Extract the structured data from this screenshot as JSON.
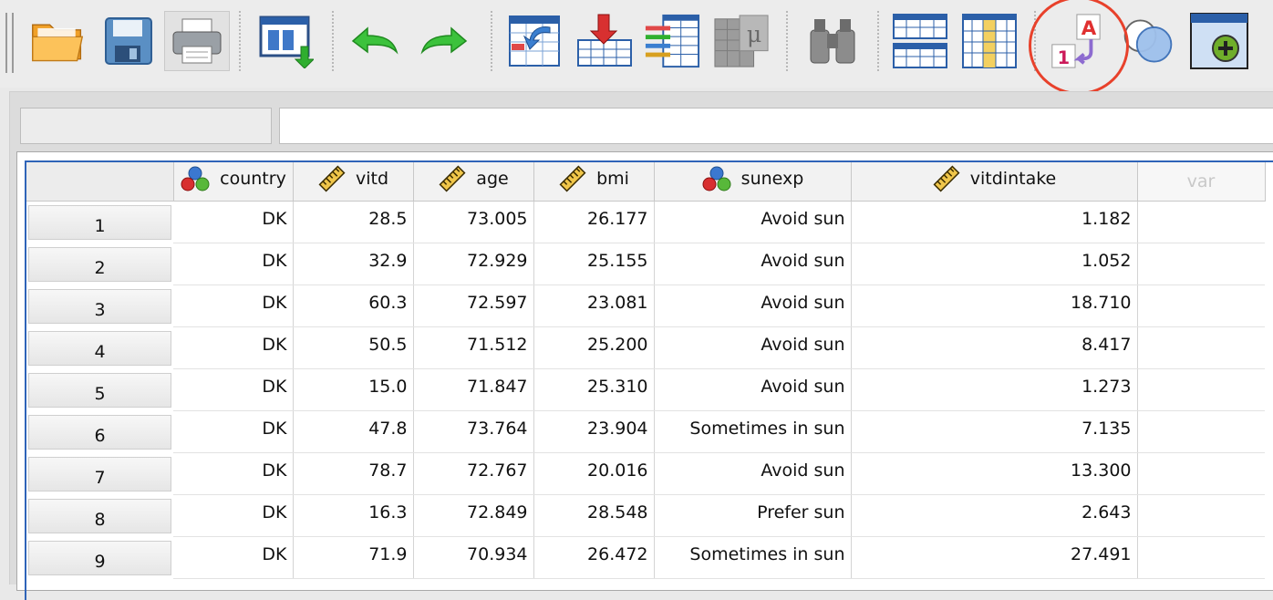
{
  "toolbar": {
    "buttons": [
      {
        "name": "open-data-button",
        "icon": "folder-open-icon"
      },
      {
        "name": "save-button",
        "icon": "floppy-disk-icon"
      },
      {
        "name": "print-button",
        "icon": "printer-icon"
      },
      {
        "name": "recall-dialog-button",
        "icon": "recall-dialog-icon"
      },
      {
        "name": "undo-button",
        "icon": "undo-arrow-icon"
      },
      {
        "name": "redo-button",
        "icon": "redo-arrow-icon"
      },
      {
        "name": "go-to-case-button",
        "icon": "go-to-case-icon"
      },
      {
        "name": "go-to-variable-button",
        "icon": "go-to-variable-icon"
      },
      {
        "name": "variables-button",
        "icon": "variables-list-icon"
      },
      {
        "name": "run-descriptives-button",
        "icon": "mu-statistics-icon"
      },
      {
        "name": "find-button",
        "icon": "binoculars-icon"
      },
      {
        "name": "insert-cases-button",
        "icon": "insert-cases-icon"
      },
      {
        "name": "insert-variable-button",
        "icon": "insert-variable-icon"
      },
      {
        "name": "value-labels-button",
        "icon": "value-labels-icon"
      },
      {
        "name": "use-variable-sets-button",
        "icon": "variable-sets-circles-icon"
      },
      {
        "name": "add-extension-button",
        "icon": "add-plus-icon"
      }
    ]
  },
  "colors": {
    "annotation": "#e8412b",
    "grid_frame": "#2f64b8",
    "header_bg": "#f2f2f2"
  },
  "grid": {
    "columns": [
      {
        "label": "country",
        "icon": "nominal-measure-icon",
        "align": "right"
      },
      {
        "label": "vitd",
        "icon": "scale-ruler-icon",
        "align": "right"
      },
      {
        "label": "age",
        "icon": "scale-ruler-icon",
        "align": "right"
      },
      {
        "label": "bmi",
        "icon": "scale-ruler-icon",
        "align": "right"
      },
      {
        "label": "sunexp",
        "icon": "nominal-measure-icon",
        "align": "right"
      },
      {
        "label": "vitdintake",
        "icon": "scale-ruler-icon",
        "align": "right"
      },
      {
        "label": "var",
        "icon": "",
        "align": "right"
      }
    ],
    "rows": [
      {
        "num": "1",
        "cells": [
          "DK",
          "28.5",
          "73.005",
          "26.177",
          "Avoid sun",
          "1.182",
          ""
        ]
      },
      {
        "num": "2",
        "cells": [
          "DK",
          "32.9",
          "72.929",
          "25.155",
          "Avoid sun",
          "1.052",
          ""
        ]
      },
      {
        "num": "3",
        "cells": [
          "DK",
          "60.3",
          "72.597",
          "23.081",
          "Avoid sun",
          "18.710",
          ""
        ]
      },
      {
        "num": "4",
        "cells": [
          "DK",
          "50.5",
          "71.512",
          "25.200",
          "Avoid sun",
          "8.417",
          ""
        ]
      },
      {
        "num": "5",
        "cells": [
          "DK",
          "15.0",
          "71.847",
          "25.310",
          "Avoid sun",
          "1.273",
          ""
        ]
      },
      {
        "num": "6",
        "cells": [
          "DK",
          "47.8",
          "73.764",
          "23.904",
          "Sometimes in sun",
          "7.135",
          ""
        ]
      },
      {
        "num": "7",
        "cells": [
          "DK",
          "78.7",
          "72.767",
          "20.016",
          "Avoid sun",
          "13.300",
          ""
        ]
      },
      {
        "num": "8",
        "cells": [
          "DK",
          "16.3",
          "72.849",
          "28.548",
          "Prefer sun",
          "2.643",
          ""
        ]
      },
      {
        "num": "9",
        "cells": [
          "DK",
          "71.9",
          "70.934",
          "26.472",
          "Sometimes in sun",
          "27.491",
          ""
        ]
      }
    ]
  }
}
